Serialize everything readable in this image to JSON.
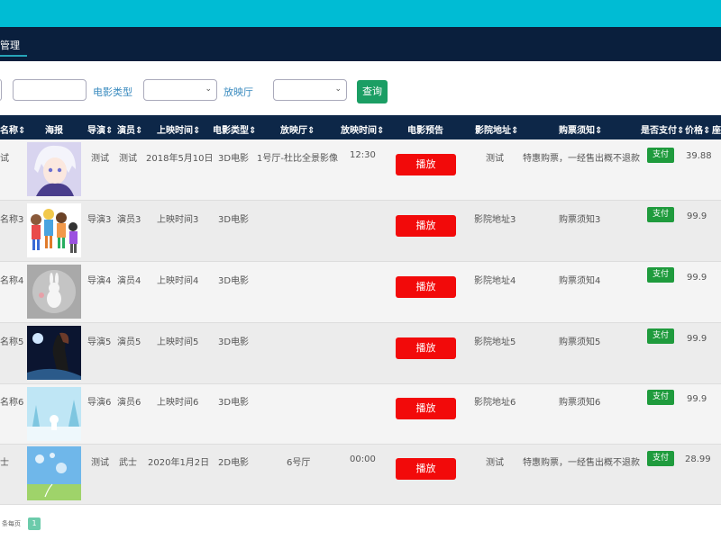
{
  "nav": {
    "title": "管理"
  },
  "filters": {
    "type_label": "电影类型",
    "hall_label": "放映厅",
    "query_label": "查询"
  },
  "table": {
    "headers": [
      "名称",
      "海报",
      "导演",
      "演员",
      "上映时间",
      "电影类型",
      "放映厅",
      "放映时间",
      "电影预告",
      "影院地址",
      "购票须知",
      "是否支付",
      "价格",
      "座"
    ],
    "sort_icon": "sort-arrows-icon",
    "rows": [
      {
        "name": "试",
        "poster": "anime-boy-poster",
        "director": "测试",
        "actor": "测试",
        "date": "2018年5月10日",
        "type": "3D电影",
        "hall": "1号厅-杜比全景影像",
        "showtime": "12:30",
        "play": "播放",
        "address": "测试",
        "notice": "特惠购票，一经售出概不退款",
        "pay": "支付",
        "price": "39.88"
      },
      {
        "name": "名称3",
        "poster": "cartoon-kids-poster",
        "director": "导演3",
        "actor": "演员3",
        "date": "上映时间3",
        "type": "3D电影",
        "hall": "",
        "showtime": "",
        "play": "播放",
        "address": "影院地址3",
        "notice": "购票须知3",
        "pay": "支付",
        "price": "99.9"
      },
      {
        "name": "名称4",
        "poster": "bunny-poster",
        "director": "导演4",
        "actor": "演员4",
        "date": "上映时间4",
        "type": "3D电影",
        "hall": "",
        "showtime": "",
        "play": "播放",
        "address": "影院地址4",
        "notice": "购票须知4",
        "pay": "支付",
        "price": "99.9"
      },
      {
        "name": "名称5",
        "poster": "dark-figure-poster",
        "director": "导演5",
        "actor": "演员5",
        "date": "上映时间5",
        "type": "3D电影",
        "hall": "",
        "showtime": "",
        "play": "播放",
        "address": "影院地址5",
        "notice": "购票须知5",
        "pay": "支付",
        "price": "99.9"
      },
      {
        "name": "名称6",
        "poster": "snow-scene-poster",
        "director": "导演6",
        "actor": "演员6",
        "date": "上映时间6",
        "type": "3D电影",
        "hall": "",
        "showtime": "",
        "play": "播放",
        "address": "影院地址6",
        "notice": "购票须知6",
        "pay": "支付",
        "price": "99.9"
      },
      {
        "name": "士",
        "poster": "dandelion-poster",
        "director": "测试",
        "actor": "武士",
        "date": "2020年1月2日",
        "type": "2D电影",
        "hall": "6号厅",
        "showtime": "00:00",
        "play": "播放",
        "address": "测试",
        "notice": "特惠购票，一经售出概不退款",
        "pay": "支付",
        "price": "28.99"
      }
    ]
  },
  "pagination": {
    "prev_label": "条每页",
    "page": "1"
  },
  "colors": {
    "topbar": "#00bcd4",
    "navbar": "#0a1f3d",
    "header": "#0d2748",
    "play": "#f20a0a",
    "pay": "#1f9b3d",
    "query": "#1b9e64"
  }
}
